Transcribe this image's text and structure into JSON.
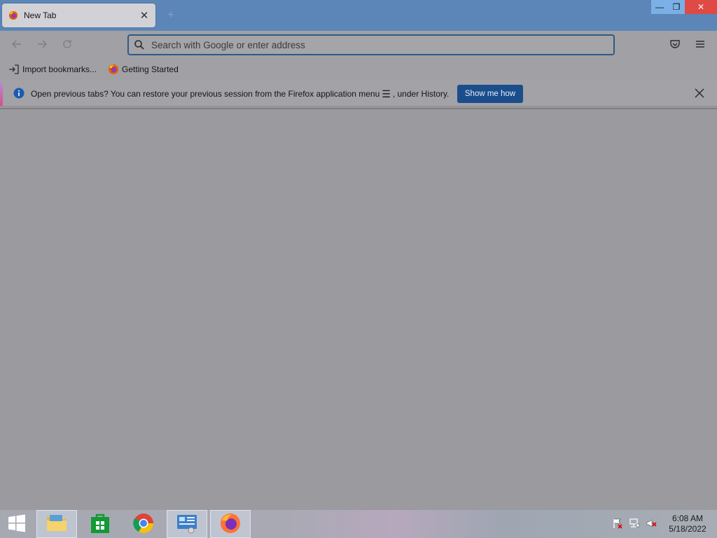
{
  "browser": {
    "tab": {
      "title": "New Tab",
      "close_glyph": "✕"
    },
    "new_tab_glyph": "+",
    "window_controls": {
      "minimize": "—",
      "restore": "❐",
      "close": "✕"
    },
    "urlbar": {
      "placeholder": "Search with Google or enter address",
      "value": ""
    },
    "bookmarks": [
      {
        "label": "Import bookmarks...",
        "icon": "import-icon"
      },
      {
        "label": "Getting Started",
        "icon": "firefox-icon"
      }
    ],
    "notification": {
      "text_before_icon": "Open previous tabs? You can restore your previous session from the Firefox application menu",
      "menu_glyph": "☰",
      "text_after_icon": ", under History.",
      "button_label": "Show me how",
      "close_glyph": "✕"
    }
  },
  "taskbar": {
    "items": [
      {
        "name": "start",
        "icon": "windows-logo-icon"
      },
      {
        "name": "file-explorer",
        "icon": "folder-icon"
      },
      {
        "name": "store",
        "icon": "store-icon"
      },
      {
        "name": "chrome",
        "icon": "chrome-icon"
      },
      {
        "name": "control-panel",
        "icon": "control-panel-icon"
      },
      {
        "name": "firefox",
        "icon": "firefox-icon"
      }
    ],
    "clock": {
      "time": "6:08 AM",
      "date": "5/18/2022"
    }
  },
  "colors": {
    "accent_button": "#1a4d8c",
    "titlebar": "#5b86b7",
    "close_button": "#e04a44"
  }
}
